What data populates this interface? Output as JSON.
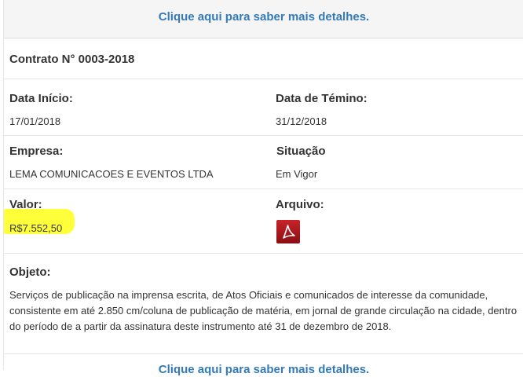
{
  "header": {
    "details_link": "Clique aqui para saber mais detalhes."
  },
  "contract": {
    "title": "Contrato N° 0003-2018",
    "start_date": {
      "label": "Data Início:",
      "value": "17/01/2018"
    },
    "end_date": {
      "label": "Data de Témino:",
      "value": "31/12/2018"
    },
    "company": {
      "label": "Empresa:",
      "value": "LEMA COMUNICACOES E EVENTOS LTDA"
    },
    "status": {
      "label": "Situação",
      "value": "Em Vigor"
    },
    "amount": {
      "label": "Valor:",
      "value": "R$7.552,50",
      "highlight_color": "#ffff3a"
    },
    "file": {
      "label": "Arquivo:",
      "icon": "pdf-file-icon",
      "icon_color": "#b0171a"
    },
    "object": {
      "label": "Objeto:",
      "text": "Serviços de publicação na imprensa escrita, de Atos Oficiais e comunicados de interesse da comunidade, consistente em até 2.850 cm/coluna de publicação de matéria, em jornal de grande circulação na cidade, dentro do período de a partir da assinatura deste instrumento até 31 de dezembro de 2018."
    }
  },
  "footer": {
    "details_link": "Clique aqui para saber mais detalhes."
  },
  "colors": {
    "link": "#337ab7",
    "text": "#333333",
    "divider": "#e5e5e5"
  }
}
